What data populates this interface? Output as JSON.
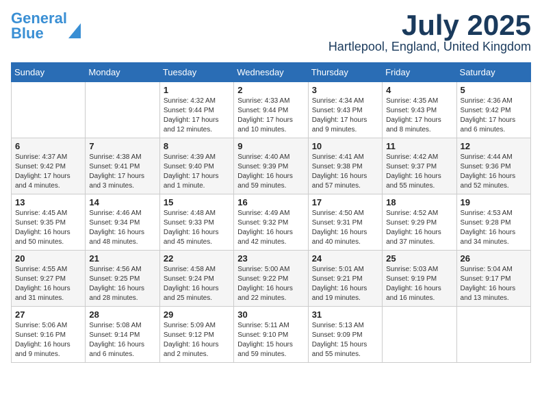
{
  "logo": {
    "line1": "General",
    "line2": "Blue"
  },
  "title": {
    "month": "July 2025",
    "location": "Hartlepool, England, United Kingdom"
  },
  "weekdays": [
    "Sunday",
    "Monday",
    "Tuesday",
    "Wednesday",
    "Thursday",
    "Friday",
    "Saturday"
  ],
  "weeks": [
    [
      {
        "day": "",
        "info": ""
      },
      {
        "day": "",
        "info": ""
      },
      {
        "day": "1",
        "info": "Sunrise: 4:32 AM\nSunset: 9:44 PM\nDaylight: 17 hours and 12 minutes."
      },
      {
        "day": "2",
        "info": "Sunrise: 4:33 AM\nSunset: 9:44 PM\nDaylight: 17 hours and 10 minutes."
      },
      {
        "day": "3",
        "info": "Sunrise: 4:34 AM\nSunset: 9:43 PM\nDaylight: 17 hours and 9 minutes."
      },
      {
        "day": "4",
        "info": "Sunrise: 4:35 AM\nSunset: 9:43 PM\nDaylight: 17 hours and 8 minutes."
      },
      {
        "day": "5",
        "info": "Sunrise: 4:36 AM\nSunset: 9:42 PM\nDaylight: 17 hours and 6 minutes."
      }
    ],
    [
      {
        "day": "6",
        "info": "Sunrise: 4:37 AM\nSunset: 9:42 PM\nDaylight: 17 hours and 4 minutes."
      },
      {
        "day": "7",
        "info": "Sunrise: 4:38 AM\nSunset: 9:41 PM\nDaylight: 17 hours and 3 minutes."
      },
      {
        "day": "8",
        "info": "Sunrise: 4:39 AM\nSunset: 9:40 PM\nDaylight: 17 hours and 1 minute."
      },
      {
        "day": "9",
        "info": "Sunrise: 4:40 AM\nSunset: 9:39 PM\nDaylight: 16 hours and 59 minutes."
      },
      {
        "day": "10",
        "info": "Sunrise: 4:41 AM\nSunset: 9:38 PM\nDaylight: 16 hours and 57 minutes."
      },
      {
        "day": "11",
        "info": "Sunrise: 4:42 AM\nSunset: 9:37 PM\nDaylight: 16 hours and 55 minutes."
      },
      {
        "day": "12",
        "info": "Sunrise: 4:44 AM\nSunset: 9:36 PM\nDaylight: 16 hours and 52 minutes."
      }
    ],
    [
      {
        "day": "13",
        "info": "Sunrise: 4:45 AM\nSunset: 9:35 PM\nDaylight: 16 hours and 50 minutes."
      },
      {
        "day": "14",
        "info": "Sunrise: 4:46 AM\nSunset: 9:34 PM\nDaylight: 16 hours and 48 minutes."
      },
      {
        "day": "15",
        "info": "Sunrise: 4:48 AM\nSunset: 9:33 PM\nDaylight: 16 hours and 45 minutes."
      },
      {
        "day": "16",
        "info": "Sunrise: 4:49 AM\nSunset: 9:32 PM\nDaylight: 16 hours and 42 minutes."
      },
      {
        "day": "17",
        "info": "Sunrise: 4:50 AM\nSunset: 9:31 PM\nDaylight: 16 hours and 40 minutes."
      },
      {
        "day": "18",
        "info": "Sunrise: 4:52 AM\nSunset: 9:29 PM\nDaylight: 16 hours and 37 minutes."
      },
      {
        "day": "19",
        "info": "Sunrise: 4:53 AM\nSunset: 9:28 PM\nDaylight: 16 hours and 34 minutes."
      }
    ],
    [
      {
        "day": "20",
        "info": "Sunrise: 4:55 AM\nSunset: 9:27 PM\nDaylight: 16 hours and 31 minutes."
      },
      {
        "day": "21",
        "info": "Sunrise: 4:56 AM\nSunset: 9:25 PM\nDaylight: 16 hours and 28 minutes."
      },
      {
        "day": "22",
        "info": "Sunrise: 4:58 AM\nSunset: 9:24 PM\nDaylight: 16 hours and 25 minutes."
      },
      {
        "day": "23",
        "info": "Sunrise: 5:00 AM\nSunset: 9:22 PM\nDaylight: 16 hours and 22 minutes."
      },
      {
        "day": "24",
        "info": "Sunrise: 5:01 AM\nSunset: 9:21 PM\nDaylight: 16 hours and 19 minutes."
      },
      {
        "day": "25",
        "info": "Sunrise: 5:03 AM\nSunset: 9:19 PM\nDaylight: 16 hours and 16 minutes."
      },
      {
        "day": "26",
        "info": "Sunrise: 5:04 AM\nSunset: 9:17 PM\nDaylight: 16 hours and 13 minutes."
      }
    ],
    [
      {
        "day": "27",
        "info": "Sunrise: 5:06 AM\nSunset: 9:16 PM\nDaylight: 16 hours and 9 minutes."
      },
      {
        "day": "28",
        "info": "Sunrise: 5:08 AM\nSunset: 9:14 PM\nDaylight: 16 hours and 6 minutes."
      },
      {
        "day": "29",
        "info": "Sunrise: 5:09 AM\nSunset: 9:12 PM\nDaylight: 16 hours and 2 minutes."
      },
      {
        "day": "30",
        "info": "Sunrise: 5:11 AM\nSunset: 9:10 PM\nDaylight: 15 hours and 59 minutes."
      },
      {
        "day": "31",
        "info": "Sunrise: 5:13 AM\nSunset: 9:09 PM\nDaylight: 15 hours and 55 minutes."
      },
      {
        "day": "",
        "info": ""
      },
      {
        "day": "",
        "info": ""
      }
    ]
  ]
}
